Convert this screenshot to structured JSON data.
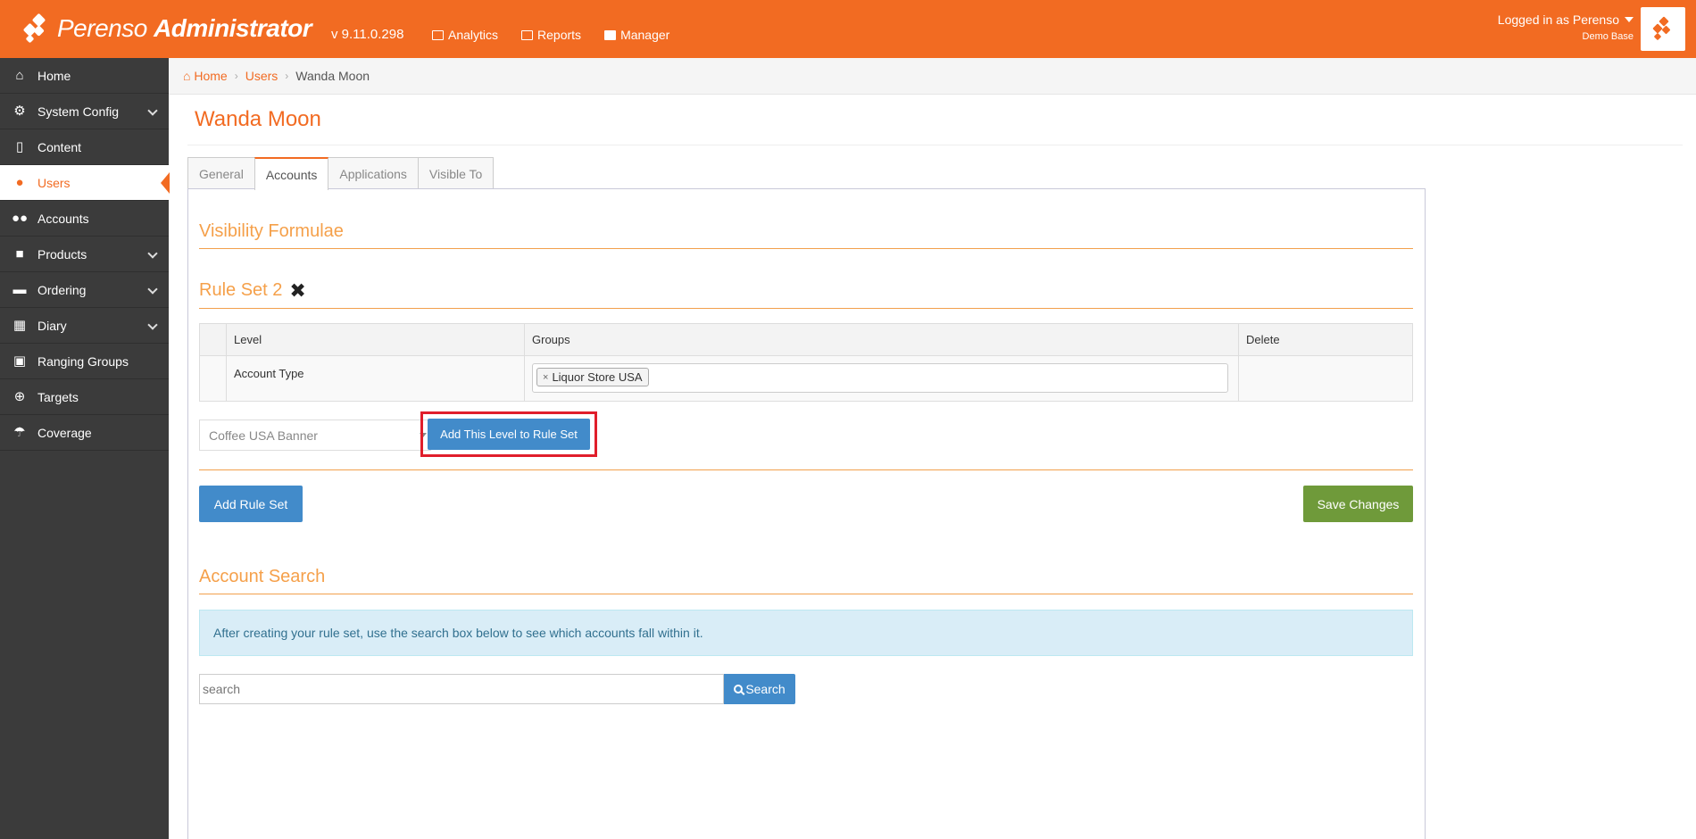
{
  "app": {
    "brand_light": "Perenso",
    "brand_bold": "Administrator",
    "version": "v 9.11.0.298",
    "accent": "#f26b22"
  },
  "topnav": [
    {
      "label": "Analytics",
      "icon": "chart-icon"
    },
    {
      "label": "Reports",
      "icon": "table-icon"
    },
    {
      "label": "Manager",
      "icon": "briefcase-icon"
    }
  ],
  "user": {
    "logged_in": "Logged in as Perenso",
    "base": "Demo Base"
  },
  "sidebar": {
    "items": [
      {
        "label": "Home",
        "icon": "home-icon"
      },
      {
        "label": "System Config",
        "icon": "gear-icon"
      },
      {
        "label": "Content",
        "icon": "file-icon"
      },
      {
        "label": "Users",
        "icon": "user-icon"
      },
      {
        "label": "Accounts",
        "icon": "users-icon"
      },
      {
        "label": "Products",
        "icon": "gift-icon"
      },
      {
        "label": "Ordering",
        "icon": "cart-icon"
      },
      {
        "label": "Diary",
        "icon": "calendar-icon"
      },
      {
        "label": "Ranging Groups",
        "icon": "cubes-icon"
      },
      {
        "label": "Targets",
        "icon": "crosshairs-icon"
      },
      {
        "label": "Coverage",
        "icon": "umbrella-icon"
      }
    ]
  },
  "breadcrumb": {
    "home": "Home",
    "users": "Users",
    "current": "Wanda Moon"
  },
  "page": {
    "title": "Wanda Moon"
  },
  "tabs": [
    "General",
    "Accounts",
    "Applications",
    "Visible To"
  ],
  "visibility": {
    "heading": "Visibility Formulae",
    "rule_set_title": "Rule Set 2",
    "table": {
      "headers": [
        "",
        "Level",
        "Groups",
        "Delete"
      ],
      "rows": [
        {
          "level": "Account Type",
          "tag": "Liquor Store USA",
          "tag_remove": "×"
        }
      ]
    },
    "level_select_value": "Coffee USA Banner",
    "add_level_label": "Add This Level to Rule Set",
    "add_rule_set_label": "Add Rule Set",
    "save_label": "Save Changes"
  },
  "account_search": {
    "heading": "Account Search",
    "info": "After creating your rule set, use the search box below to see which accounts fall within it.",
    "placeholder": "search",
    "button_label": "Search"
  }
}
